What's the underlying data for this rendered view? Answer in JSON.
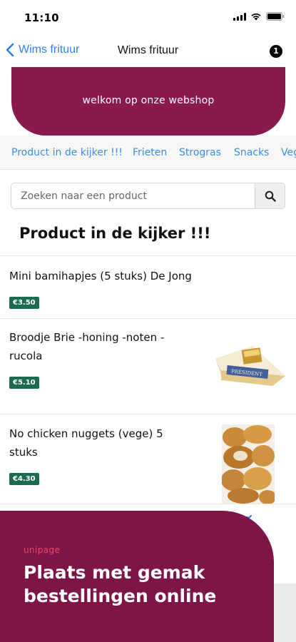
{
  "status": {
    "time": "11:10"
  },
  "nav": {
    "back_label": "Wims frituur",
    "title": "Wims frituur",
    "badge_count": "1"
  },
  "banner": {
    "text": "welkom op onze webshop"
  },
  "categories": [
    "Product in de kijker !!!",
    "Frieten",
    "Strogras",
    "Snacks",
    "Veg"
  ],
  "search": {
    "placeholder": "Zoeken naar een product"
  },
  "section_title": "Product in de kijker !!!",
  "products": [
    {
      "name": "Mini bamihapjes (5 stuks) De Jong",
      "price": "€3.50"
    },
    {
      "name": "Broodje Brie -honing -noten -\nrucola",
      "price": "€5.10",
      "image": "cheese-wedge"
    },
    {
      "name": "No chicken nuggets (vege) 5\nstuks",
      "price": "€4.30",
      "image": "nuggets"
    }
  ],
  "promo": {
    "logo": "unipage",
    "title": "Plaats met gemak\nbestellingen online"
  },
  "colors": {
    "brand": "#8a1a4e",
    "link": "#3a8dde",
    "price": "#1a6b4f"
  }
}
